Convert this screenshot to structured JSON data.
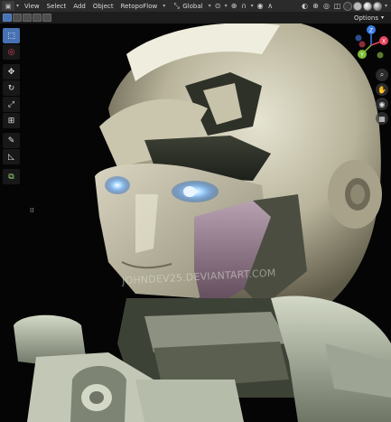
{
  "header": {
    "menus": [
      "View",
      "Select",
      "Add",
      "Object"
    ],
    "addon_menu": "RetopoFlow",
    "transform_orientation": "Global"
  },
  "row2": {
    "options_label": "Options"
  },
  "viewport": {
    "watermark": "JOHNDEV25.DEVIANTART.COM"
  },
  "toolbar": {
    "tools": [
      "select-box-icon",
      "cursor-icon",
      "move-icon",
      "rotate-icon",
      "scale-icon",
      "transform-icon",
      "annotate-icon",
      "measure-icon",
      "add-cube-icon"
    ]
  },
  "gizmo": {
    "axes": [
      "X",
      "Y",
      "Z"
    ]
  },
  "colors": {
    "header_bg": "#2b2b2b",
    "active_tool": "#4772b3",
    "axis_x": "#e8435b",
    "axis_y": "#7dbd38",
    "axis_z": "#3a7ee8",
    "eye_glow": "#6ab4ff"
  }
}
